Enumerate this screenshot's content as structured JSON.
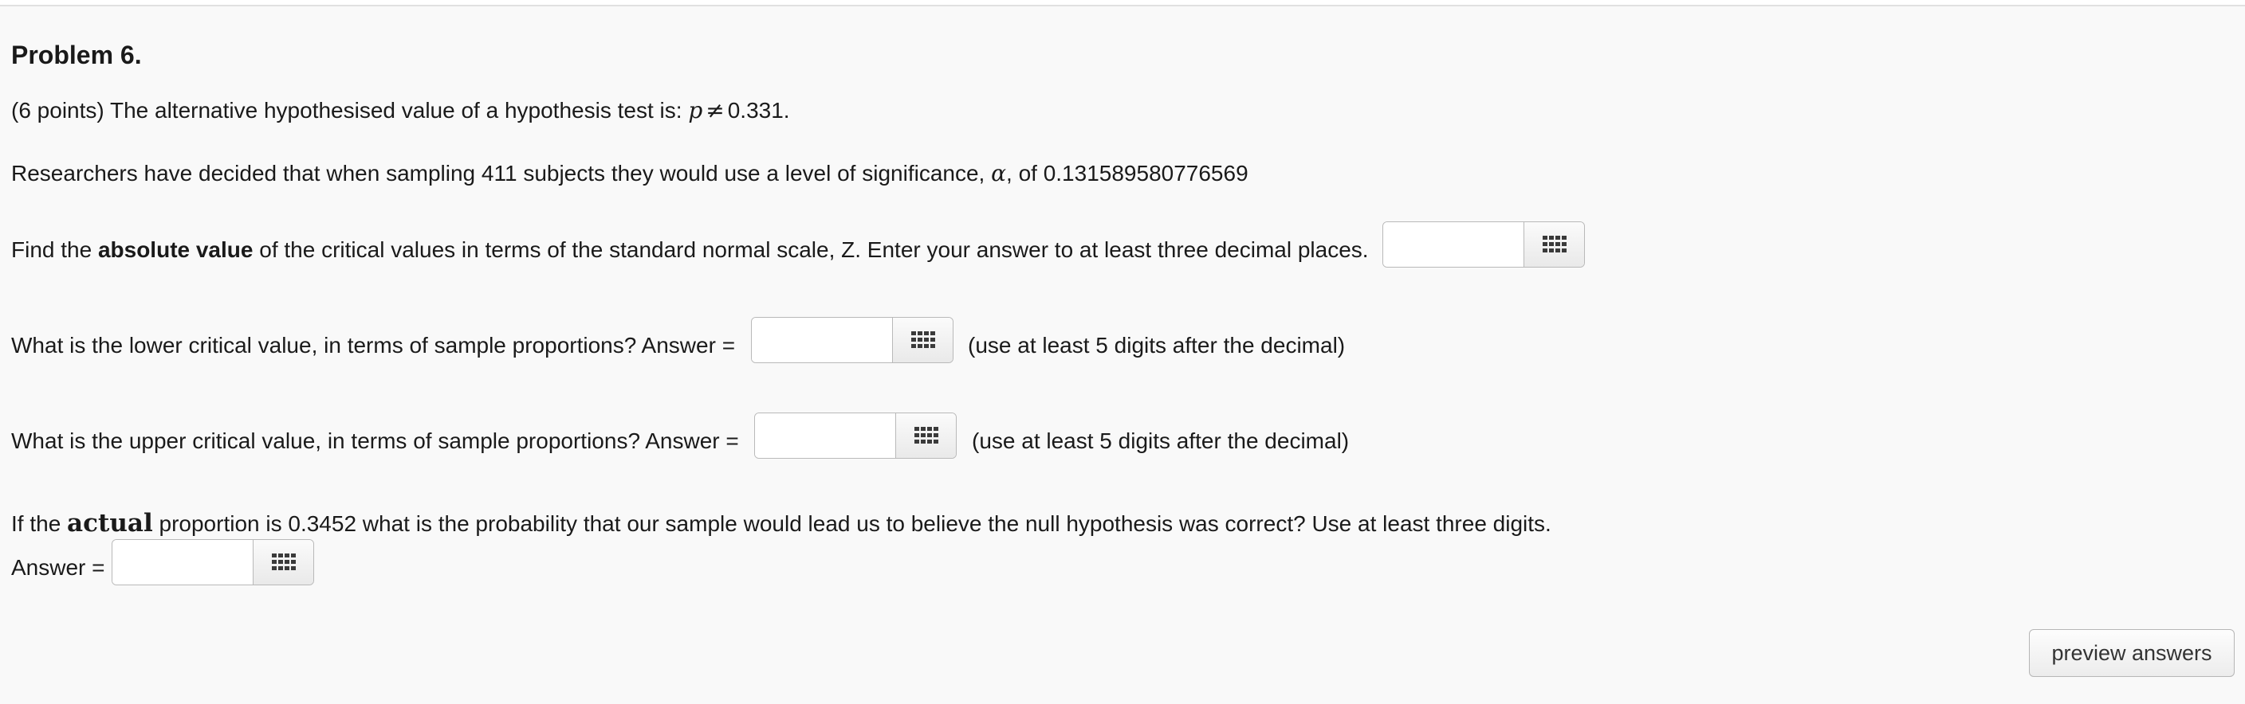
{
  "problem": {
    "title": "Problem 6.",
    "intro_prefix": "(6 points) The alternative hypothesised value of a hypothesis test is:",
    "intro_var": "p",
    "intro_op": "≠",
    "intro_value": "0.331.",
    "researchers_prefix": "Researchers have decided that when sampling 411 subjects they would use a level of significance,",
    "alpha_symbol": "α",
    "researchers_suffix": ", of 0.131589580776569",
    "q1_prefix": "Find the",
    "q1_bold": "absolute value",
    "q1_suffix": "of the critical values in terms of the standard normal scale, Z. Enter your answer to at least three decimal places.",
    "q2_text": "What is the lower critical value, in terms of sample proportions? Answer =",
    "q2_hint": "(use at least 5 digits after the decimal)",
    "q3_text": "What is the upper critical value, in terms of sample proportions? Answer =",
    "q3_hint": "(use at least 5 digits after the decimal)",
    "q4_prefix": "If the",
    "q4_bold": "actual",
    "q4_suffix": "proportion is 0.3452 what is the probability that our sample would lead us to believe the null hypothesis was correct? Use at least three digits.",
    "q4_answer_label": "Answer ="
  },
  "answers": {
    "q1_value": "",
    "q2_value": "",
    "q3_value": "",
    "q4_value": ""
  },
  "buttons": {
    "preview_label": "preview answers"
  },
  "icons": {
    "palette": "grid-icon"
  }
}
